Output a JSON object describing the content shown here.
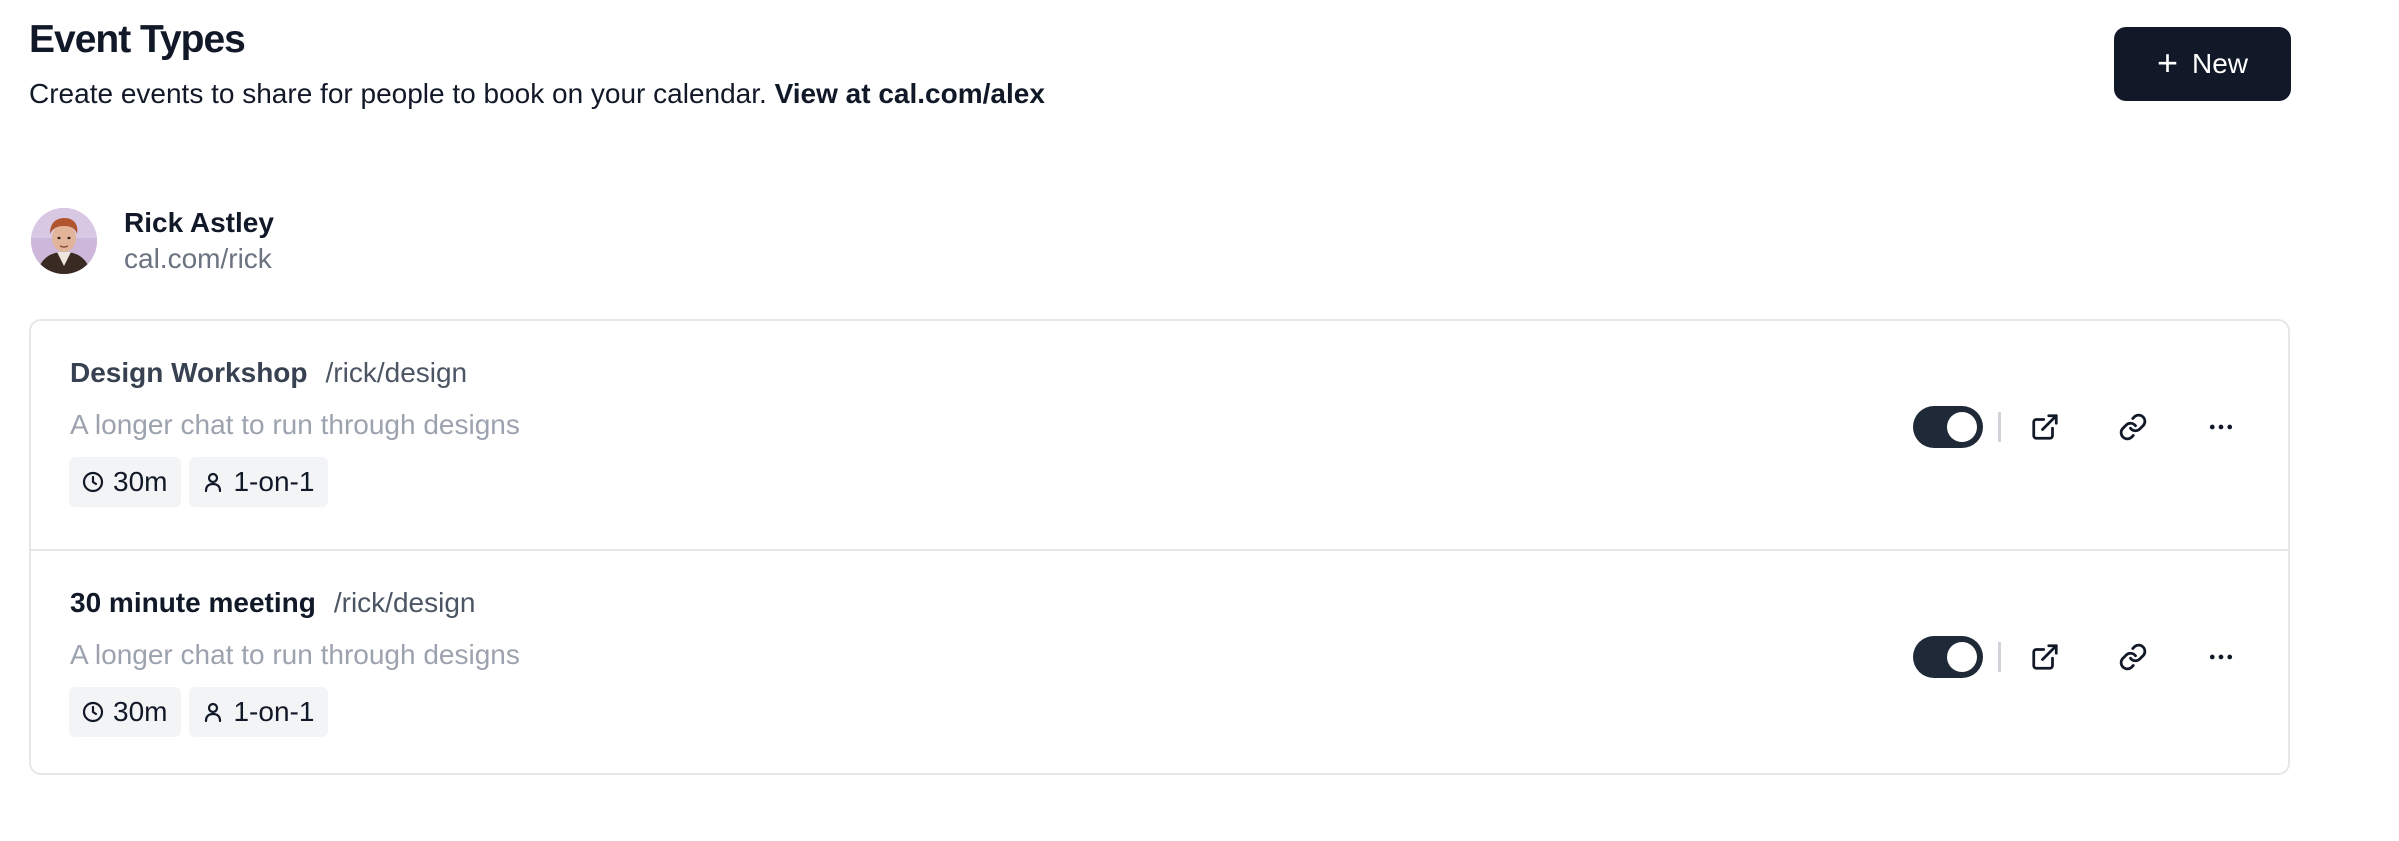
{
  "header": {
    "title": "Event Types",
    "subtitle": "Create events to share for people to book on your calendar.",
    "view_link": "View at cal.com/alex",
    "new_button_label": "New"
  },
  "profile": {
    "name": "Rick Astley",
    "url": "cal.com/rick"
  },
  "event_types": [
    {
      "title": "Design Workshop",
      "slug": "/rick/design",
      "description": "A longer chat to run through designs",
      "duration": "30m",
      "type": "1-on-1",
      "enabled": true
    },
    {
      "title": "30 minute meeting",
      "slug": "/rick/design",
      "description": "A longer chat to run through designs",
      "duration": "30m",
      "type": "1-on-1",
      "enabled": true
    }
  ],
  "colors": {
    "primary": "#111827",
    "toggle_on": "#1f2937",
    "muted_text": "#9ca3af",
    "border": "#e5e7eb",
    "badge_bg": "#f3f4f6"
  },
  "icons": {
    "new": "plus-icon",
    "duration": "clock-icon",
    "type": "user-icon",
    "preview": "external-link-icon",
    "copy": "link-icon",
    "more": "more-horizontal-icon"
  }
}
